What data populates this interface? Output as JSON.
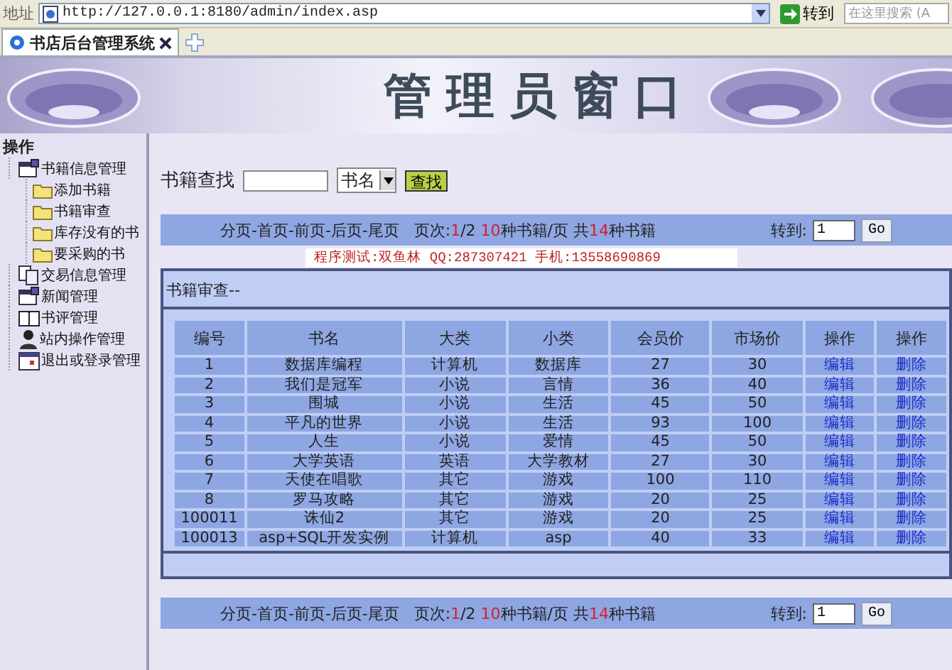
{
  "address_bar": {
    "label": "地址",
    "url": "http://127.0.0.1:8180/admin/index.asp",
    "go_button": "转到",
    "search": {
      "placeholder": "在这里搜索 (A"
    }
  },
  "tabs": [
    {
      "label": "书店后台管理系统",
      "selected": true
    }
  ],
  "banner": {
    "title": "管理员窗口"
  },
  "sidebar": {
    "heading": "操作",
    "items": [
      {
        "label": "书籍信息管理",
        "kind": "window",
        "children": [
          {
            "label": "添加书籍",
            "kind": "folder"
          },
          {
            "label": "书籍审查",
            "kind": "folder"
          },
          {
            "label": "库存没有的书",
            "kind": "folder"
          },
          {
            "label": "要采购的书",
            "kind": "folder"
          }
        ]
      },
      {
        "label": "交易信息管理",
        "kind": "docs"
      },
      {
        "label": "新闻管理",
        "kind": "window"
      },
      {
        "label": "书评管理",
        "kind": "book"
      },
      {
        "label": "站内操作管理",
        "kind": "person"
      },
      {
        "label": "退出或登录管理",
        "kind": "calendar"
      }
    ]
  },
  "search": {
    "label": "书籍查找",
    "field_select": "书名",
    "button": "查找"
  },
  "pagers": [
    {
      "segments": [
        {
          "text": "分页-首页-前页-后页-尾页   页次:",
          "highlight": false
        },
        {
          "text": "1",
          "highlight": true
        },
        {
          "text": "/2 ",
          "highlight": false
        },
        {
          "text": "10",
          "highlight": true
        },
        {
          "text": "种书籍/页 共",
          "highlight": false
        },
        {
          "text": "14",
          "highlight": true
        },
        {
          "text": "种书籍",
          "highlight": false
        }
      ],
      "goto_label": "转到:",
      "goto_value": "1",
      "go_button": "Go"
    },
    {
      "segments": [
        {
          "text": "分页-首页-前页-后页-尾页   页次:",
          "highlight": false
        },
        {
          "text": "1",
          "highlight": true
        },
        {
          "text": "/2 ",
          "highlight": false
        },
        {
          "text": "10",
          "highlight": true
        },
        {
          "text": "种书籍/页 共",
          "highlight": false
        },
        {
          "text": "14",
          "highlight": true
        },
        {
          "text": "种书籍",
          "highlight": false
        }
      ],
      "goto_label": "转到:",
      "goto_value": "1",
      "go_button": "Go"
    }
  ],
  "contact": "程序测试:双鱼林 QQ:287307421 手机:13558690869",
  "panel": {
    "title": "书籍审查--",
    "table": {
      "columns": [
        "编号",
        "书名",
        "大类",
        "小类",
        "会员价",
        "市场价",
        "操作",
        "操作"
      ],
      "rows": [
        [
          "1",
          "数据库编程",
          "计算机",
          "数据库",
          "27",
          "30",
          "编辑",
          "删除"
        ],
        [
          "2",
          "我们是冠军",
          "小说",
          "言情",
          "36",
          "40",
          "编辑",
          "删除"
        ],
        [
          "3",
          "围城",
          "小说",
          "生活",
          "45",
          "50",
          "编辑",
          "删除"
        ],
        [
          "4",
          "平凡的世界",
          "小说",
          "生活",
          "93",
          "100",
          "编辑",
          "删除"
        ],
        [
          "5",
          "人生",
          "小说",
          "爱情",
          "45",
          "50",
          "编辑",
          "删除"
        ],
        [
          "6",
          "大学英语",
          "英语",
          "大学教材",
          "27",
          "30",
          "编辑",
          "删除"
        ],
        [
          "7",
          "天使在唱歌",
          "其它",
          "游戏",
          "100",
          "110",
          "编辑",
          "删除"
        ],
        [
          "8",
          "罗马攻略",
          "其它",
          "游戏",
          "20",
          "25",
          "编辑",
          "删除"
        ],
        [
          "100011",
          "诛仙2",
          "其它",
          "游戏",
          "20",
          "25",
          "编辑",
          "删除"
        ],
        [
          "100013",
          "asp+SQL开发实例",
          "计算机",
          "asp",
          "40",
          "33",
          "编辑",
          "删除"
        ]
      ]
    }
  }
}
